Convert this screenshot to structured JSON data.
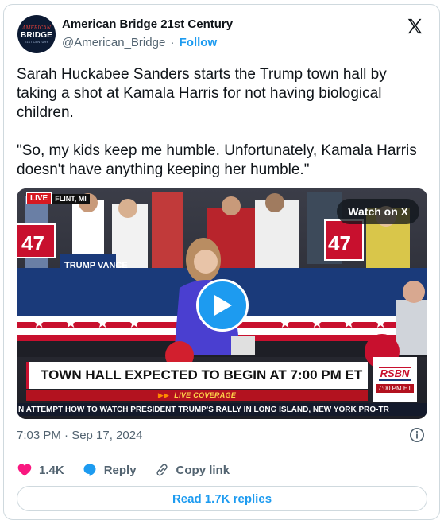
{
  "author": {
    "name": "American Bridge 21st Century",
    "handle": "@American_Bridge",
    "separator": "·",
    "follow_label": "Follow",
    "avatar": {
      "top": "AMERICAN",
      "main": "BRIDGE",
      "sub": "21ST CENTURY"
    }
  },
  "tweet": {
    "text": "Sarah Huckabee Sanders starts the Trump town hall by taking a shot at Kamala Harris for not having biological children.\n\n\"So, my kids keep me humble. Unfortunately, Kamala Harris doesn't have anything keeping her humble.\""
  },
  "media": {
    "live_label": "LIVE",
    "location": "FLINT, MI",
    "watch_label": "Watch on X",
    "headline": "TOWN HALL EXPECTED TO BEGIN AT 7:00 PM ET",
    "live_coverage": "LIVE COVERAGE",
    "network": "RSBN",
    "network_time": "7:00 PM ET",
    "ticker": "N ATTEMPT   HOW TO WATCH PRESIDENT TRUMP'S RALLY IN LONG ISLAND, NEW YORK   PRO-TR",
    "signs": {
      "sign_47": "47",
      "trump_vance": "TRUMP VANCE"
    }
  },
  "timestamp": "7:03 PM · Sep 17, 2024",
  "actions": {
    "likes": "1.4K",
    "reply_label": "Reply",
    "copy_label": "Copy link"
  },
  "read_replies_label": "Read 1.7K replies",
  "colors": {
    "accent": "#1d9bf0",
    "like": "#f91880",
    "text": "#0f1419",
    "muted": "#536471"
  }
}
